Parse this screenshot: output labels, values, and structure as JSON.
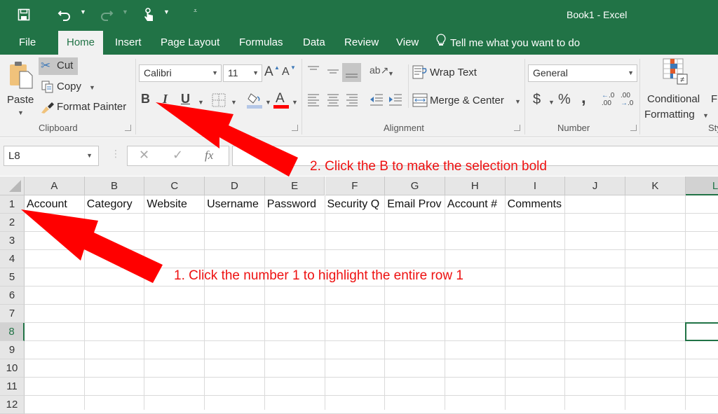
{
  "titlebar": {
    "title": "Book1 - Excel",
    "quick_access": [
      {
        "name": "save-icon",
        "glyph": "🖫"
      },
      {
        "name": "undo-icon",
        "glyph": "↶"
      },
      {
        "name": "redo-icon",
        "glyph": "↷"
      },
      {
        "name": "touch-mode-icon",
        "glyph": "☝"
      },
      {
        "name": "customize-qat-icon",
        "glyph": "▾"
      }
    ]
  },
  "tabs": [
    {
      "label": "File",
      "active": false
    },
    {
      "label": "Home",
      "active": true
    },
    {
      "label": "Insert",
      "active": false
    },
    {
      "label": "Page Layout",
      "active": false
    },
    {
      "label": "Formulas",
      "active": false
    },
    {
      "label": "Data",
      "active": false
    },
    {
      "label": "Review",
      "active": false
    },
    {
      "label": "View",
      "active": false
    }
  ],
  "tell_me": "Tell me what you want to do",
  "ribbon": {
    "clipboard": {
      "label": "Clipboard",
      "paste": "Paste",
      "cut": "Cut",
      "copy": "Copy",
      "format_painter": "Format Painter"
    },
    "font": {
      "font_name": "Calibri",
      "font_size": "11",
      "bold": "B",
      "italic": "I",
      "underline": "U",
      "font_color": "#ff0000",
      "fill_color": "#b4c7e7"
    },
    "alignment": {
      "label": "Alignment",
      "wrap_text": "Wrap Text",
      "merge_center": "Merge & Center"
    },
    "number": {
      "label": "Number",
      "format": "General",
      "currency": "$",
      "percent": "%",
      "comma": ",",
      "inc_decimal": ".00",
      "dec_decimal": ".0"
    },
    "styles": {
      "conditional_line1": "Conditional",
      "conditional_line2": "Formatting",
      "format_as_table_partial": "F",
      "label_partial": "Sty"
    }
  },
  "formula_bar": {
    "name_box": "L8",
    "cancel": "✕",
    "enter": "✓",
    "fx": "fx",
    "value": ""
  },
  "sheet": {
    "columns": [
      "A",
      "B",
      "C",
      "D",
      "E",
      "F",
      "G",
      "H",
      "I",
      "J",
      "K",
      "L"
    ],
    "selected_column": "L",
    "rows": [
      "1",
      "2",
      "3",
      "4",
      "5",
      "6",
      "7",
      "8",
      "9",
      "10",
      "11",
      "12"
    ],
    "selected_row": "8",
    "active_cell": "L8",
    "row1": [
      "Account",
      "Category",
      "Website",
      "Username",
      "Password",
      "Security Q",
      "Email Prov",
      "Account #",
      "Comments",
      "",
      "",
      ""
    ]
  },
  "annotations": {
    "step1": "1. Click the number 1 to highlight the entire row 1",
    "step2": "2. Click the B to make the selection bold",
    "color": "#ff0000"
  }
}
